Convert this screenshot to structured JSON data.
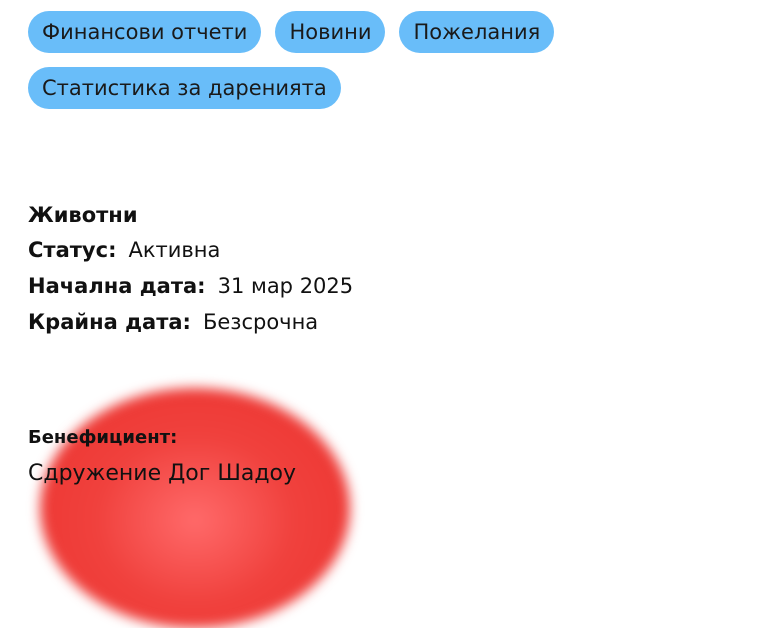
{
  "tags": [
    [
      "Финансови отчети",
      "Новини",
      "Пожелания"
    ],
    [
      "Статистика за даренията"
    ]
  ],
  "campaign": {
    "category": "Животни",
    "status_label": "Статус:",
    "status_value": "Активна",
    "start_label": "Начална дата:",
    "start_value": "31 мар 2025",
    "end_label": "Крайна дата:",
    "end_value": "Безсрочна"
  },
  "beneficiary": {
    "label": "Бенефициент:",
    "name": "Сдружение Дог Шадоу"
  },
  "colors": {
    "tag_background": "#69bdf9",
    "blob": "#ee3a36"
  }
}
